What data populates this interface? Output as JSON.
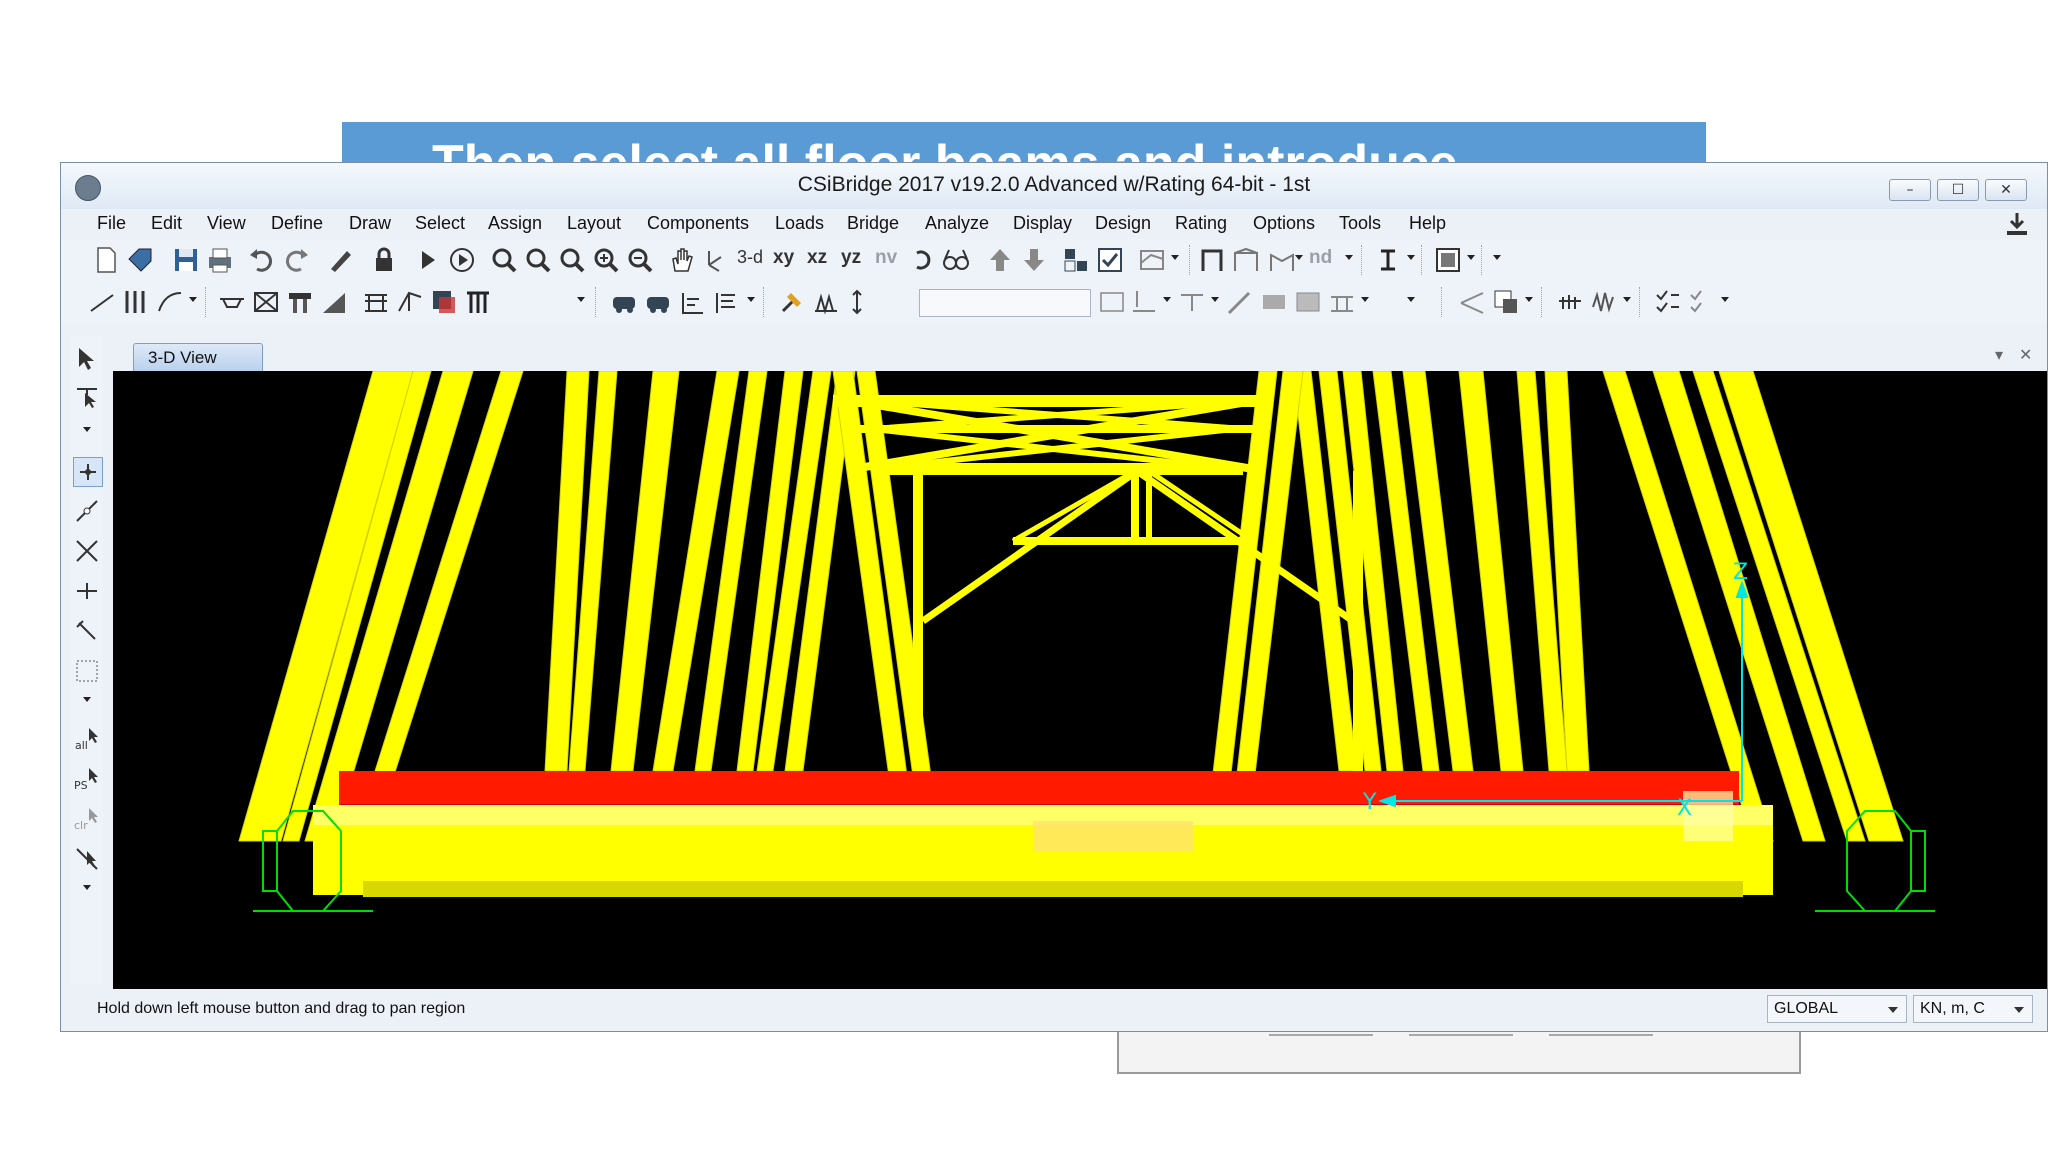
{
  "slide": {
    "banner_text": "Then select all floor beams and introduce"
  },
  "window": {
    "title": "CSiBridge 2017 v19.2.0 Advanced w/Rating 64-bit - 1st",
    "controls": {
      "minimize": "–",
      "maximize": "☐",
      "close": "✕"
    }
  },
  "menu": {
    "items": [
      "File",
      "Edit",
      "View",
      "Define",
      "Draw",
      "Select",
      "Assign",
      "Layout",
      "Components",
      "Loads",
      "Bridge",
      "Analyze",
      "Display",
      "Design",
      "Rating",
      "Options",
      "Tools",
      "Help"
    ]
  },
  "toolbar": {
    "view_3d": "3-d",
    "view_xy": "xy",
    "view_xz": "xz",
    "view_yz": "yz",
    "view_nv": "nv",
    "nd": "nd",
    "combo_value": ""
  },
  "tabs": {
    "active": "3-D View",
    "pin": "▾",
    "close": "✕"
  },
  "left_toolbar": {
    "all_label": "all",
    "ps_label": "PS",
    "clr_label": "clr"
  },
  "axes": {
    "z": "Z",
    "y": "Y",
    "x": "X"
  },
  "colors": {
    "members": "#ffff00",
    "deck": "#ff1a00",
    "supports": "#00dd00",
    "axes": "#00e5e5",
    "background": "#000000"
  },
  "status": {
    "message": "Hold down left mouse button and drag to pan region",
    "coord_system": "GLOBAL",
    "units": "KN, m, C"
  }
}
